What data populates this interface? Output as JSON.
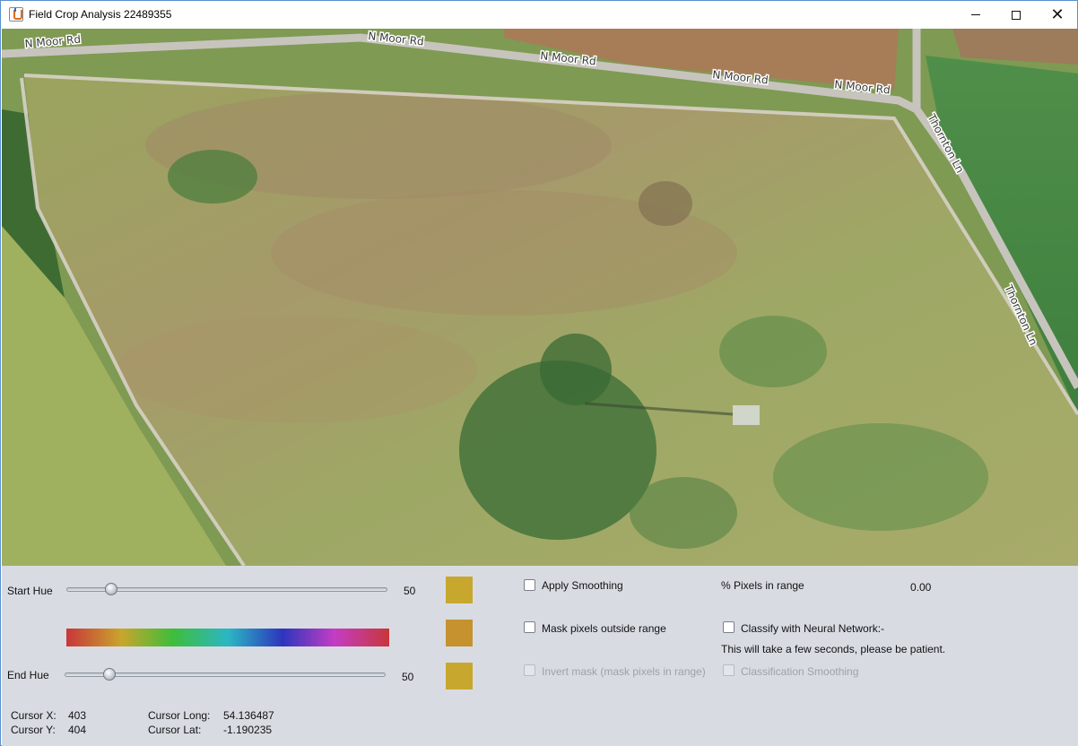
{
  "window": {
    "title": "Field Crop Analysis 22489355",
    "minimize_icon": "minimize-icon",
    "maximize_icon": "maximize-icon",
    "close_icon": "close-icon",
    "close_glyph": "✕"
  },
  "map": {
    "road_labels": [
      "N Moor Rd",
      "N Moor Rd",
      "N Moor Rd",
      "N Moor Rd",
      "N Moor Rd",
      "Thornton Ln",
      "Thornton Ln"
    ]
  },
  "controls": {
    "start_hue": {
      "label": "Start Hue",
      "value": "50",
      "level": 50,
      "max": 360
    },
    "end_hue": {
      "label": "End Hue",
      "value": "50",
      "level": 50,
      "max": 360
    },
    "swatches": [
      "#c8a72e",
      "#c5922f",
      "#c8a72e"
    ],
    "apply_smoothing": {
      "label": "Apply Smoothing",
      "checked": false,
      "enabled": true
    },
    "mask_outside": {
      "label": "Mask pixels outside range",
      "checked": false,
      "enabled": true
    },
    "invert_mask": {
      "label": "Invert mask (mask pixels in range)",
      "checked": false,
      "enabled": false
    },
    "pixels_in_range": {
      "label": "% Pixels in range",
      "value": "0.00"
    },
    "classify_nn": {
      "label": "Classify with Neural Network:-",
      "checked": false,
      "enabled": true
    },
    "nn_note": "This will take a few seconds, please be patient.",
    "classification_smoothing": {
      "label": "Classification Smoothing",
      "checked": false,
      "enabled": false
    }
  },
  "status": {
    "cursor_x_label": "Cursor X:",
    "cursor_x": "403",
    "cursor_y_label": "Cursor Y:",
    "cursor_y": "404",
    "cursor_long_label": "Cursor Long:",
    "cursor_long": "54.136487",
    "cursor_lat_label": "Cursor Lat:",
    "cursor_lat": "-1.190235"
  }
}
